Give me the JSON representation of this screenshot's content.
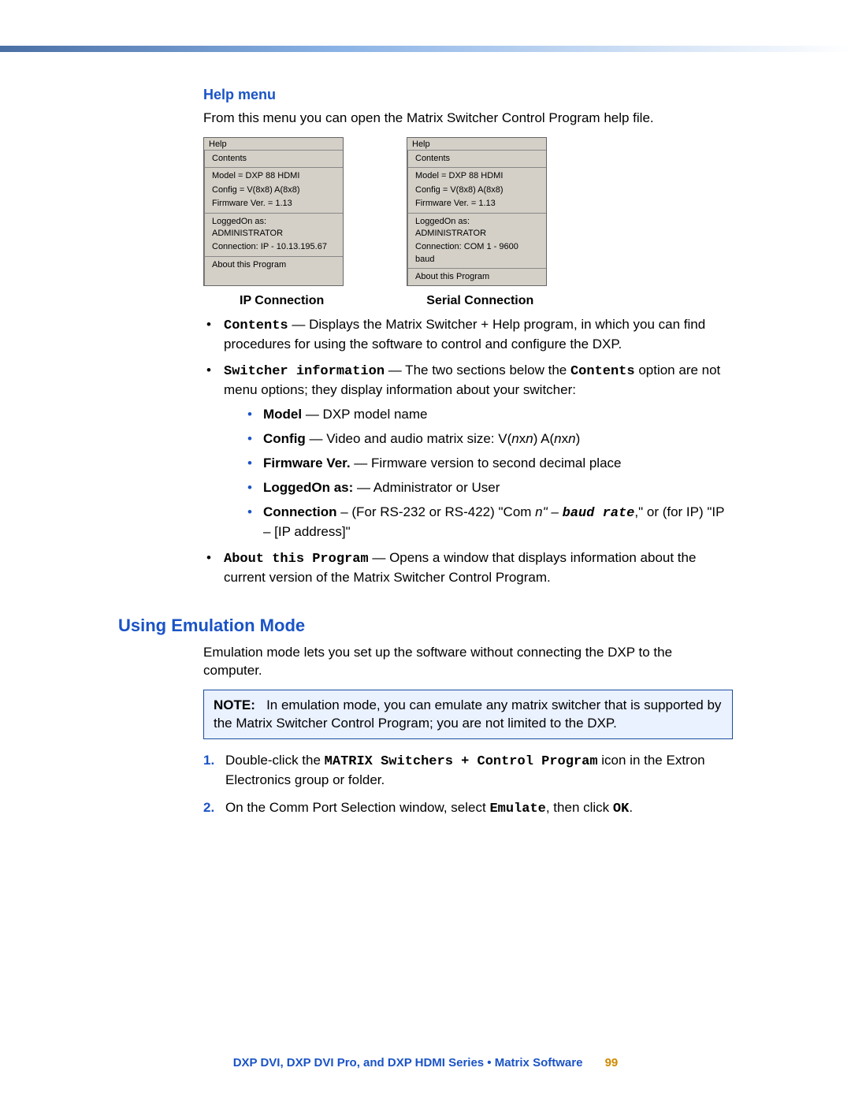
{
  "help_menu": {
    "heading": "Help menu",
    "intro": "From this menu you can open the Matrix Switcher Control Program help file.",
    "menu_ip": {
      "title": "Help",
      "contents": "Contents",
      "model": "Model = DXP 88 HDMI",
      "config": "Config = V(8x8) A(8x8)",
      "firmware": "Firmware Ver. = 1.13",
      "logged": "LoggedOn as: ADMINISTRATOR",
      "connection": "Connection: IP - 10.13.195.67",
      "about": "About this Program"
    },
    "menu_serial": {
      "title": "Help",
      "contents": "Contents",
      "model": "Model = DXP 88 HDMI",
      "config": "Config = V(8x8) A(8x8)",
      "firmware": "Firmware Ver. = 1.13",
      "logged": "LoggedOn as: ADMINISTRATOR",
      "connection": "Connection: COM 1 - 9600 baud",
      "about": "About this Program"
    },
    "caption_ip": "IP Connection",
    "caption_serial": "Serial Connection",
    "bullet_contents_code": "Contents",
    "bullet_contents_rest": " — Displays the Matrix Switcher + Help program, in which you can find procedures for using the software to control and configure the DXP.",
    "bullet_switcher_code": "Switcher information",
    "bullet_switcher_mid": " — The two sections below the ",
    "bullet_switcher_code2": "Contents",
    "bullet_switcher_end": " option are not menu options; they display information about your switcher:",
    "sub_model_b": "Model",
    "sub_model_r": " — DXP model name",
    "sub_config_b": "Config",
    "sub_config_r1": " —  Video and audio matrix size: V(",
    "sub_config_i1": "n",
    "sub_config_r2": "x",
    "sub_config_i2": "n",
    "sub_config_r3": ") A(",
    "sub_config_i3": "n",
    "sub_config_r4": "x",
    "sub_config_i4": "n",
    "sub_config_r5": ")",
    "sub_fw_b": "Firmware Ver.",
    "sub_fw_r": " — Firmware version to second decimal place",
    "sub_logged_b": "LoggedOn as:",
    "sub_logged_r": " — Administrator or User",
    "sub_conn_b": "Connection",
    "sub_conn_r1": " – (For RS-232 or RS-422) \"Com ",
    "sub_conn_i1": "n\" – ",
    "sub_conn_c1": "baud rate",
    "sub_conn_r2": ",\" or (for IP) \"IP – [IP address]\"",
    "bullet_about_code": "About this Program",
    "bullet_about_rest": " — Opens a window that displays information about the current version of the Matrix Switcher Control Program."
  },
  "emulation": {
    "heading": "Using Emulation Mode",
    "intro": "Emulation mode lets you set up the software without connecting the DXP to the computer.",
    "note_label": "NOTE:",
    "note_text": "In emulation mode, you can emulate any matrix switcher that is supported by the Matrix Switcher Control Program; you are not limited to the DXP.",
    "step1_a": "Double-click the ",
    "step1_code": "MATRIX Switchers + Control Program",
    "step1_b": " icon in the Extron Electronics group or folder.",
    "step2_a": "On the Comm Port Selection window, select ",
    "step2_code1": "Emulate",
    "step2_b": ", then click ",
    "step2_code2": "OK",
    "step2_c": "."
  },
  "footer": {
    "text": "DXP DVI, DXP DVI Pro, and DXP HDMI Series • Matrix Software",
    "page": "99"
  }
}
